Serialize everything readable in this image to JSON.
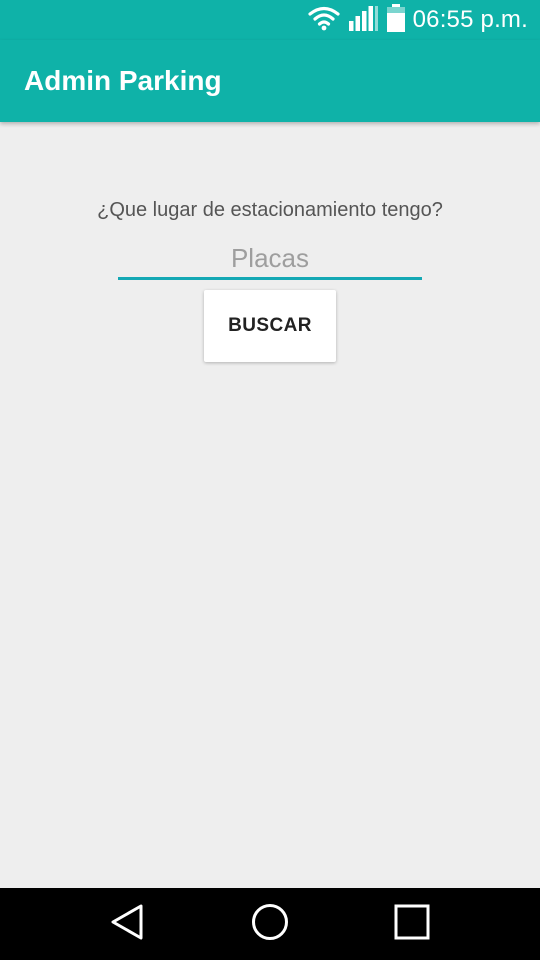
{
  "status_bar": {
    "time": "06:55 p.m.",
    "icons": [
      "wifi-icon",
      "signal-icon",
      "battery-icon"
    ]
  },
  "app_bar": {
    "title": "Admin Parking"
  },
  "main": {
    "question": "¿Que lugar de estacionamiento tengo?",
    "plate_input": {
      "placeholder": "Placas",
      "value": ""
    },
    "search_button_label": "BUSCAR"
  },
  "nav_bar": {
    "buttons": [
      "back-icon",
      "home-icon",
      "recent-apps-icon"
    ]
  },
  "colors": {
    "primary": "#0fb2a8",
    "accent": "#14a8b4",
    "background": "#eeeeee"
  }
}
